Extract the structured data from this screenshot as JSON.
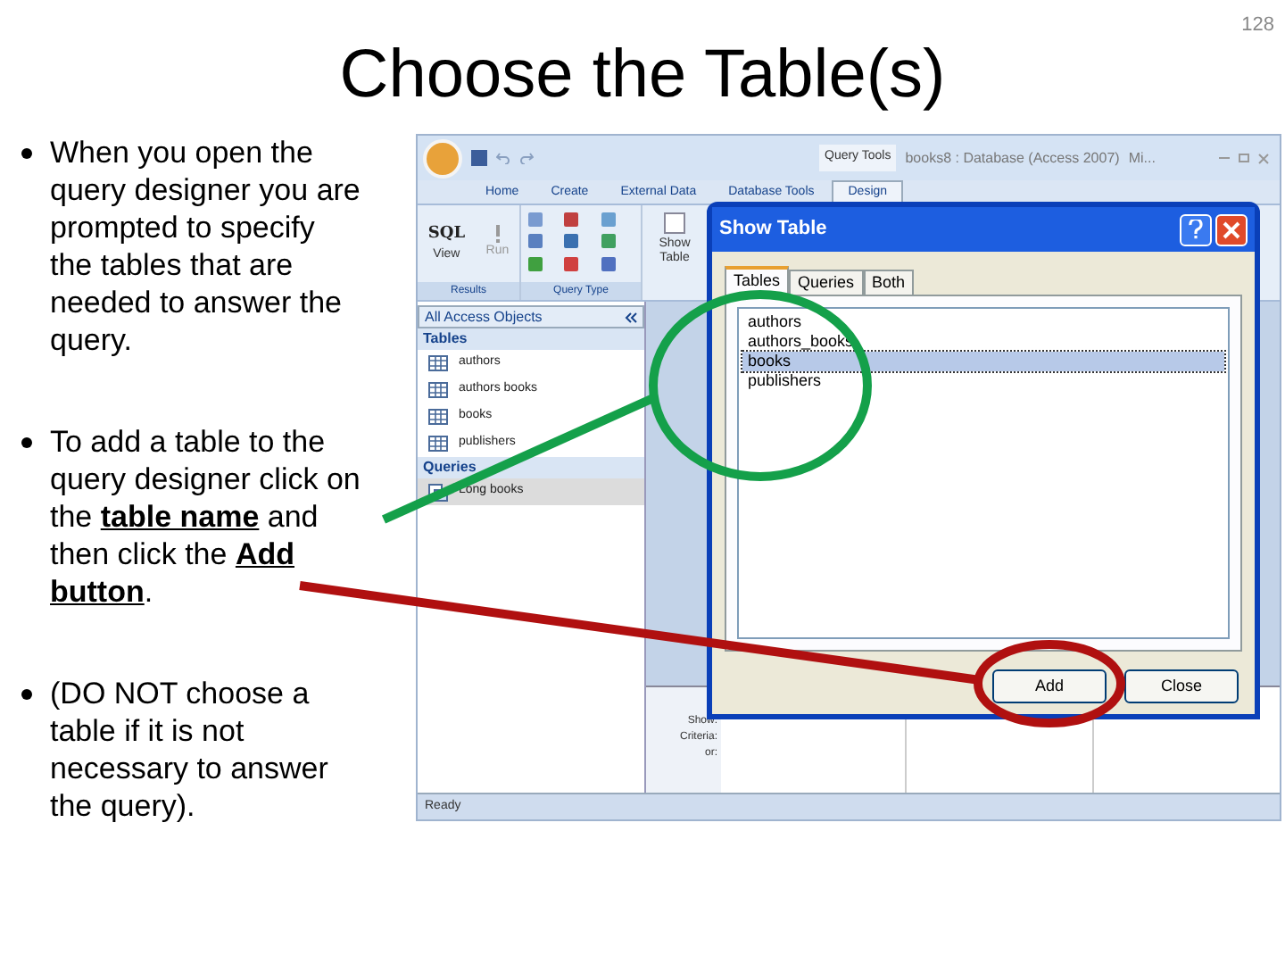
{
  "slide": {
    "title": "Choose the Table(s)",
    "page_number": "128",
    "bullets": [
      "When you open the query designer you are prompted to specify the tables that are needed to answer the query.",
      "To add a table to the query designer click on the **table name** and then click the **Add button**.",
      "(DO NOT choose a table if it is not necessary to answer the query)."
    ]
  },
  "app": {
    "context_tab": "Query Tools",
    "window_title": "books8 : Database (Access 2007)",
    "title_overflow": "Mi...",
    "ribbon_tabs": [
      {
        "label": "Home",
        "selected": false
      },
      {
        "label": "Create",
        "selected": false
      },
      {
        "label": "External Data",
        "selected": false
      },
      {
        "label": "Database Tools",
        "selected": false
      },
      {
        "label": "Design",
        "selected": true
      }
    ],
    "ribbon": {
      "sql": "SQL",
      "view": "View",
      "run": "Run",
      "group_results": "Results",
      "group_query_type": "Query Type",
      "show_table": "Show Table"
    },
    "nav": {
      "header": "All Access Objects",
      "groups": [
        {
          "label": "Tables",
          "items": [
            {
              "label": "authors",
              "kind": "table",
              "selected": false
            },
            {
              "label": "authors books",
              "kind": "table",
              "selected": false
            },
            {
              "label": "books",
              "kind": "table",
              "selected": false
            },
            {
              "label": "publishers",
              "kind": "table",
              "selected": false
            }
          ]
        },
        {
          "label": "Queries",
          "items": [
            {
              "label": "Long books",
              "kind": "query",
              "selected": true
            }
          ]
        }
      ]
    },
    "grid_labels": [
      "Show:",
      "Criteria:",
      "or:"
    ],
    "status": "Ready"
  },
  "dialog": {
    "title": "Show Table",
    "tabs": [
      {
        "label": "Tables",
        "selected": true
      },
      {
        "label": "Queries",
        "selected": false
      },
      {
        "label": "Both",
        "selected": false
      }
    ],
    "items": [
      {
        "label": "authors",
        "selected": false
      },
      {
        "label": "authors_books",
        "selected": false
      },
      {
        "label": "books",
        "selected": true
      },
      {
        "label": "publishers",
        "selected": false
      }
    ],
    "buttons": [
      "Add",
      "Close"
    ]
  }
}
